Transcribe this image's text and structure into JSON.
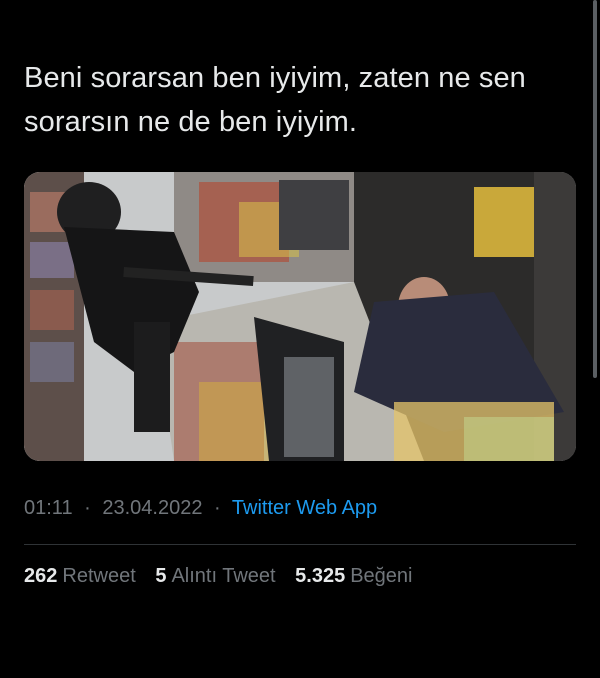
{
  "tweet": {
    "text_line1": "Beni sorarsan ben iyiyim, zaten ne sen",
    "text_line2": "sorarsın ne de ben iyiyim.",
    "time": "01:11",
    "separator": "·",
    "date": "23.04.2022",
    "source": "Twitter Web App"
  },
  "stats": {
    "retweets": {
      "count": "262",
      "label": "Retweet"
    },
    "quotes": {
      "count": "5",
      "label": "Alıntı Tweet"
    },
    "likes": {
      "count": "5.325",
      "label": "Beğeni"
    }
  },
  "colors": {
    "background": "#000000",
    "text": "#e7e9ea",
    "muted": "#71767b",
    "link": "#1d9bf0",
    "divider": "#2f3336"
  }
}
